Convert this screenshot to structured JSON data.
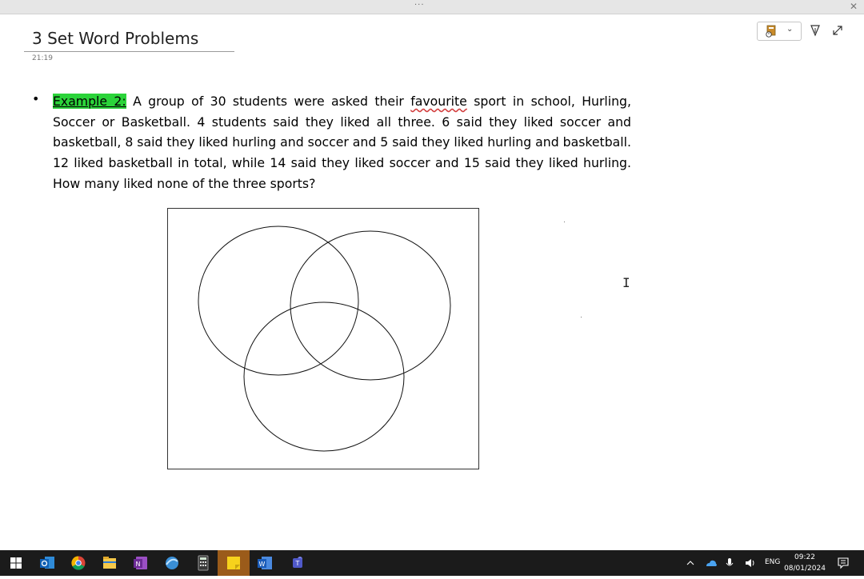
{
  "window": {
    "grip": "···",
    "close": "✕"
  },
  "page": {
    "title": "3 Set Word Problems",
    "time": "21:19"
  },
  "content": {
    "bullet": "•",
    "label": "Example 2:",
    "text_part1": " A group of 30 students were asked their ",
    "misspelled": "favourite",
    "text_part2": " sport in school, Hurling, Soccer or Basketball. 4 students said they liked all three. 6 said they liked soccer and basketball, 8 said they liked hurling and soccer and 5 said they liked hurling and basketball. 12 liked basketball in total, while 14 said they liked soccer and 15 said they liked hurling. How many liked none of the three sports?"
  },
  "toolbar": {
    "dropdown_icon": "calendar-clock-icon",
    "pen_icon": "pen-tip-icon",
    "expand_icon": "expand-icon"
  },
  "taskbar": {
    "apps": [
      "windows-start-icon",
      "outlook-icon",
      "chrome-icon",
      "file-explorer-icon",
      "onenote-icon",
      "browser-icon",
      "calculator-icon",
      "sticky-notes-icon",
      "word-icon",
      "teams-icon"
    ],
    "language": "ENG",
    "time": "09:22",
    "date": "08/01/2024"
  },
  "colors": {
    "highlight": "#2bd43a",
    "taskbar": "#1b1b1b",
    "active_app": "#9b5b1a"
  }
}
